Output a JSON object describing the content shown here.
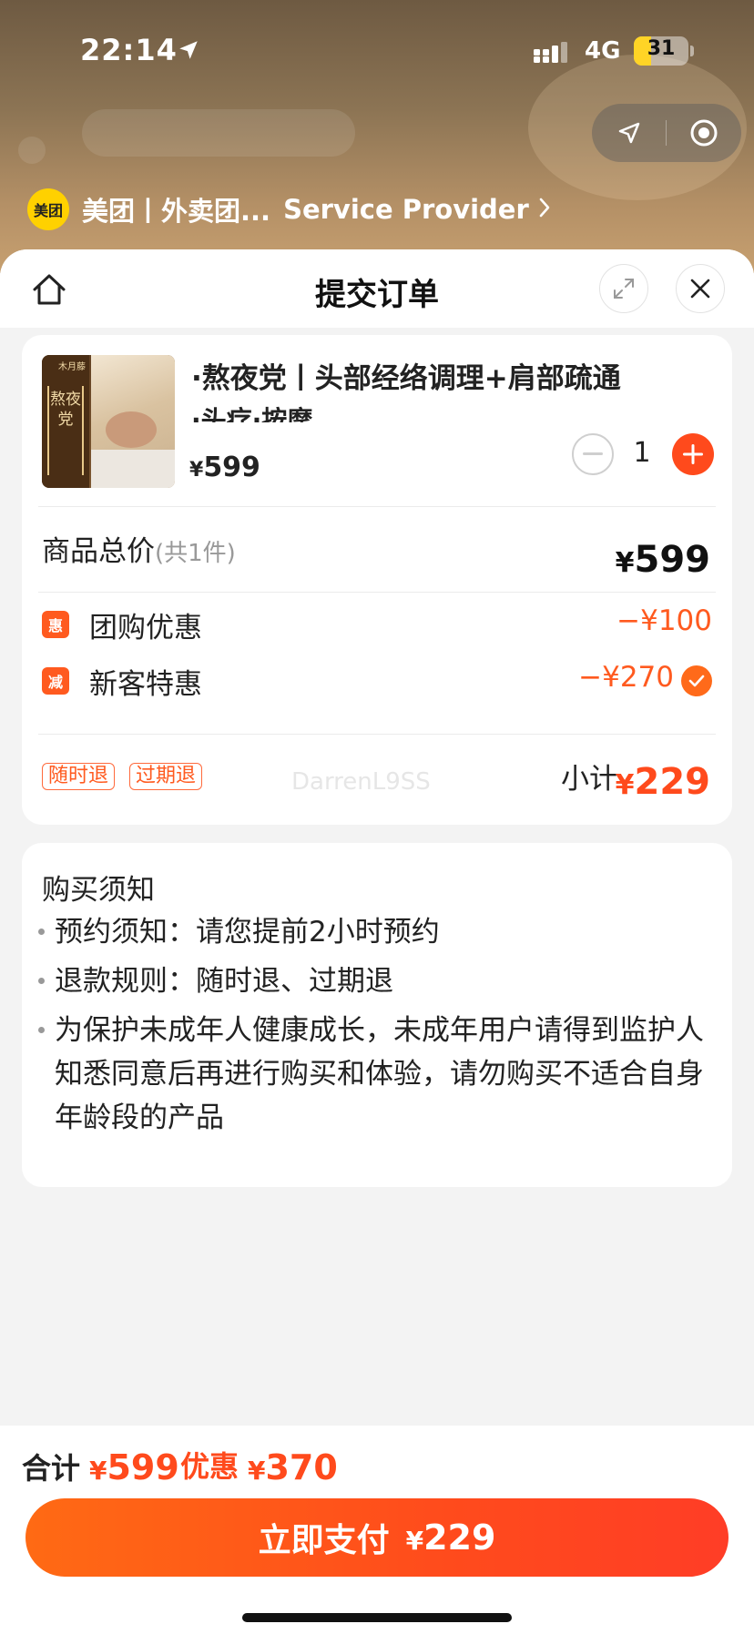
{
  "status_bar": {
    "time": "22:14",
    "network": "4G",
    "battery": "31",
    "battery_level_percent": 31
  },
  "mini_program": {
    "provider_logo_text": "美团",
    "provider_name": "美团丨外卖团...",
    "provider_link": "Service Provider"
  },
  "sheet": {
    "title": "提交订单"
  },
  "product": {
    "image_side_text": "熬夜党",
    "image_brand": "木月藤",
    "title": "·熬夜党丨头部经络调理+肩部疏通",
    "subtitle": "·头疗·按摩",
    "currency": "¥",
    "price": "599",
    "quantity": "1"
  },
  "summary": {
    "total_label": "商品总价",
    "total_count": "(共1件)",
    "currency": "¥",
    "total_amount": "599"
  },
  "discounts": [
    {
      "badge": "惠",
      "label": "团购优惠",
      "amount": "−¥100"
    },
    {
      "badge": "减",
      "label": "新客特惠",
      "amount": "−¥270"
    }
  ],
  "tags": [
    "随时退",
    "过期退"
  ],
  "watermark": "DarrenL9SS",
  "subtotal": {
    "label": "小计",
    "currency": "¥",
    "amount": "229"
  },
  "notice": {
    "title": "购买须知",
    "items": [
      "预约须知：请您提前2小时预约",
      "退款规则：随时退、过期退",
      "为保护未成年人健康成长，未成年用户请得到监护人知悉同意后再进行购买和体验，请勿购买不适合自身年龄段的产品"
    ]
  },
  "bottom_bar": {
    "sum_label": "合计",
    "sum_currency": "¥",
    "sum_amount": "599",
    "discount_label": "优惠",
    "discount_currency": "¥",
    "discount_amount": "370",
    "pay_label": "立即支付",
    "pay_currency": "¥",
    "pay_amount": "229"
  },
  "colors": {
    "accent": "#ff4a1c",
    "accent_light": "#ff6a14",
    "badge": "#ff5a1f",
    "provider_logo": "#ffd100"
  },
  "icons": {
    "home": "home-icon",
    "expand": "expand-icon",
    "close": "close-icon",
    "minus": "minus-icon",
    "plus": "plus-icon",
    "check": "check-icon",
    "location": "location-arrow-icon",
    "target": "target-icon"
  }
}
